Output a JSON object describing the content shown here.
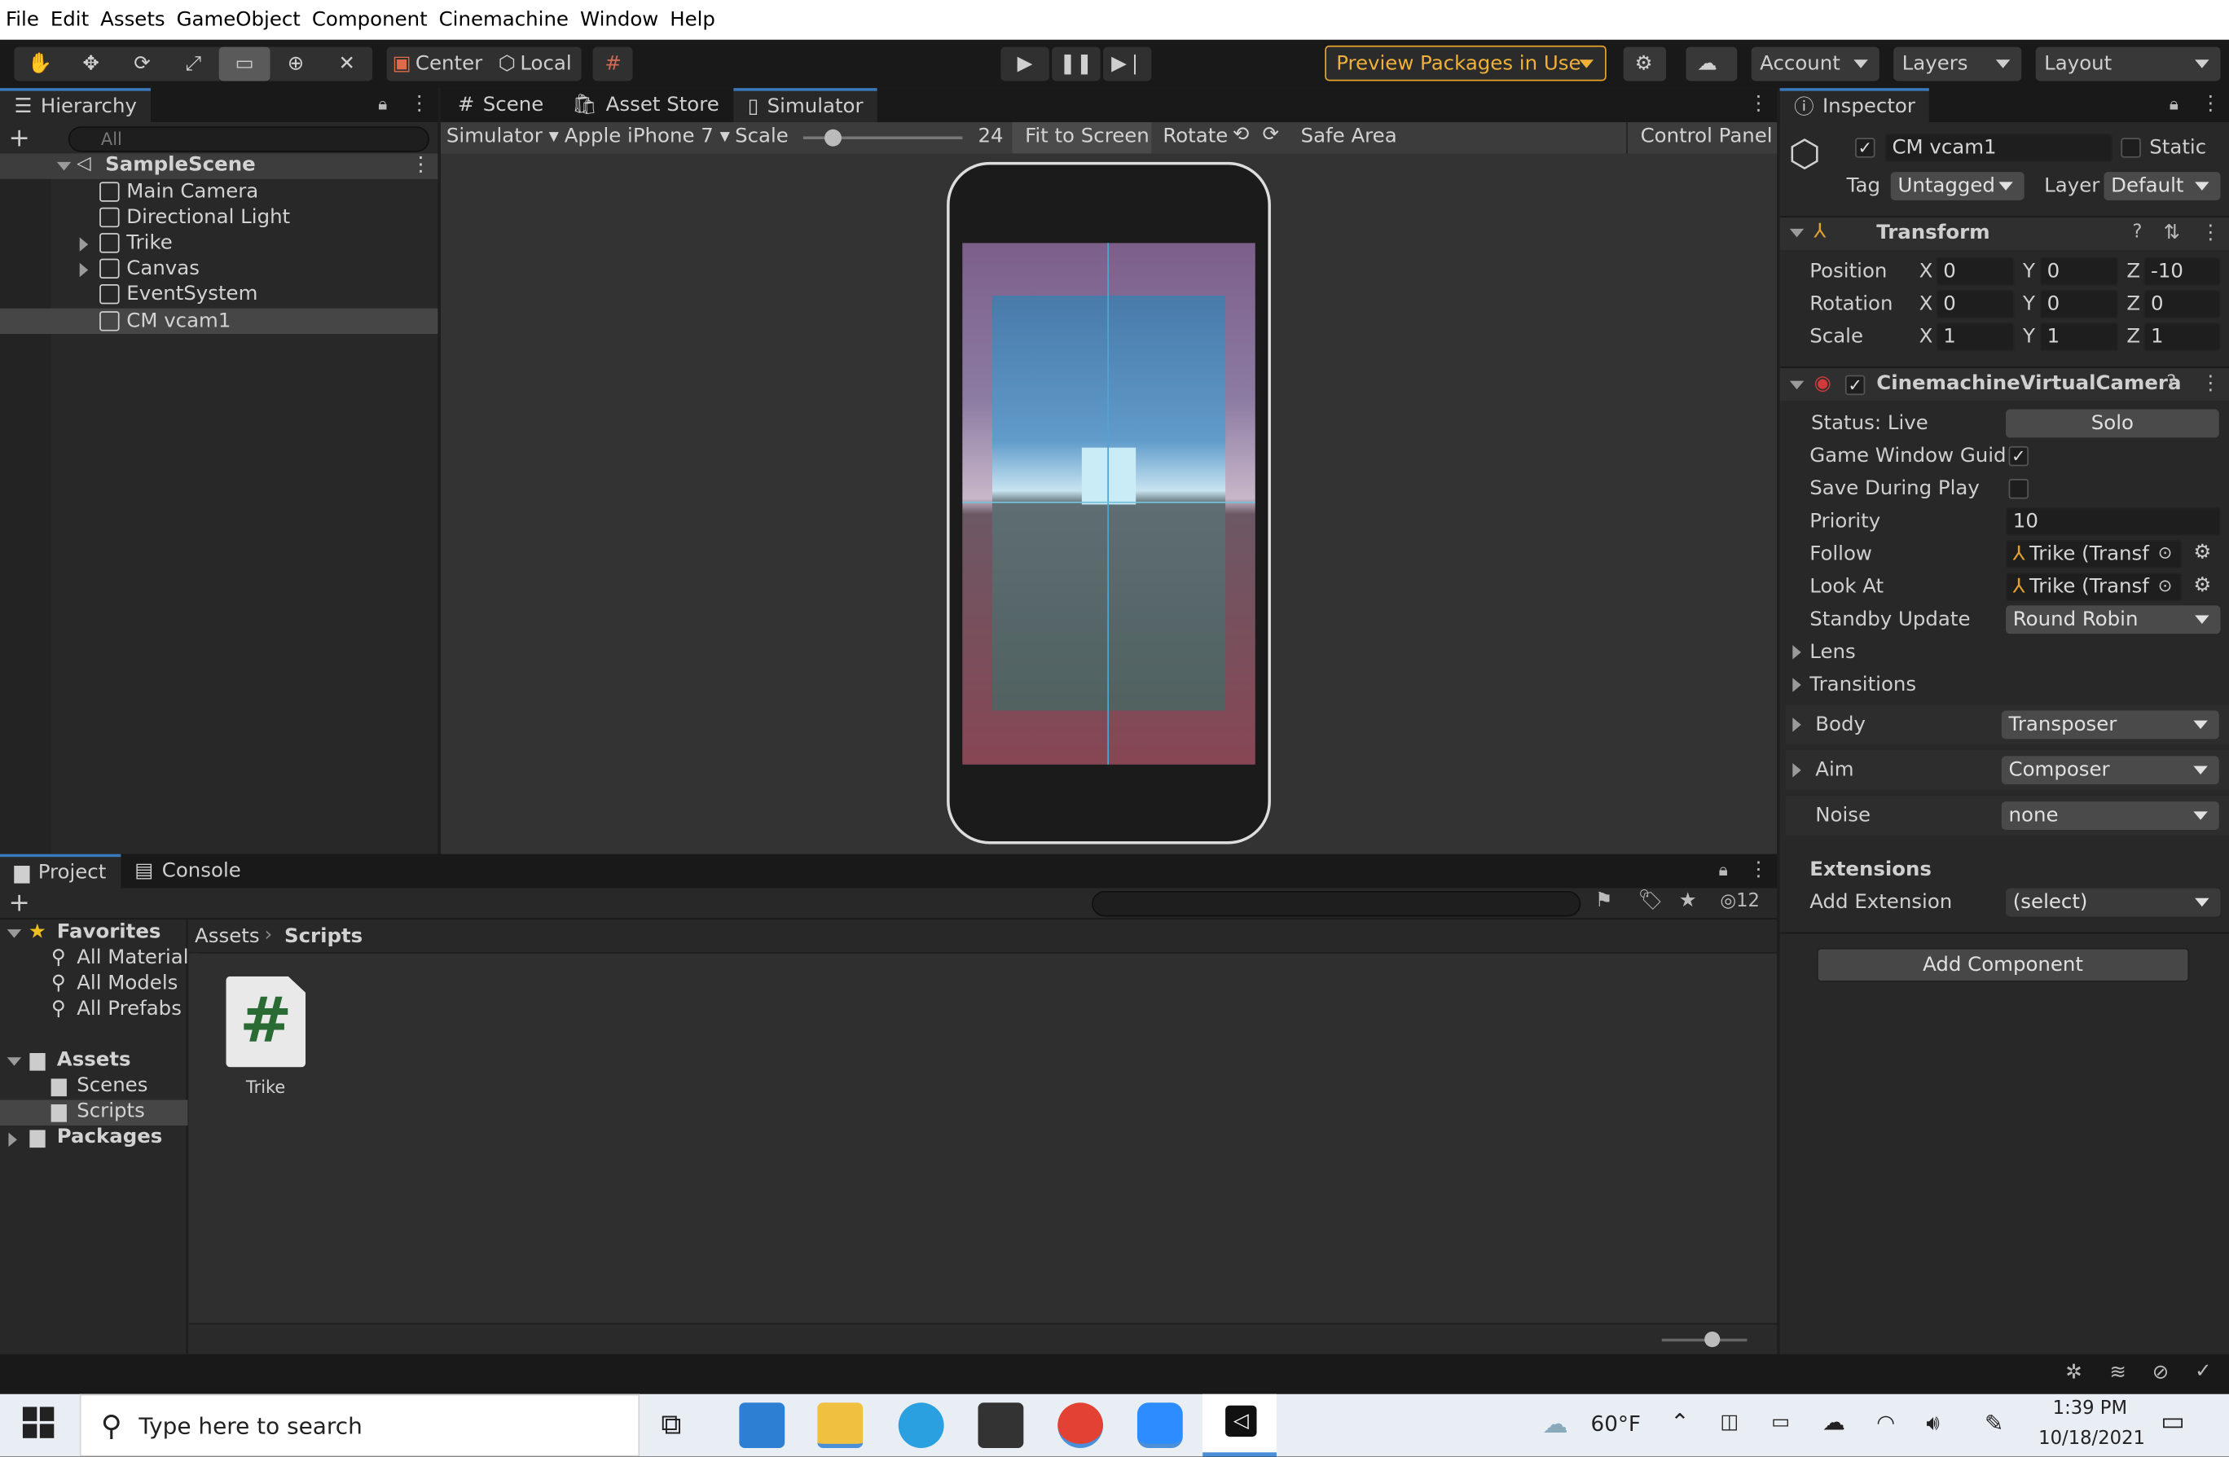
{
  "menubar": {
    "items": [
      "File",
      "Edit",
      "Assets",
      "GameObject",
      "Component",
      "Cinemachine",
      "Window",
      "Help"
    ]
  },
  "toolbar": {
    "pivot": "Center",
    "space": "Local",
    "preview_packages": "Preview Packages in Use",
    "account": "Account",
    "layers": "Layers",
    "layout": "Layout"
  },
  "hierarchy": {
    "tab": "Hierarchy",
    "search_placeholder": "All",
    "scene": "SampleScene",
    "items": [
      "Main Camera",
      "Directional Light",
      "Trike",
      "Canvas",
      "EventSystem",
      "CM vcam1"
    ]
  },
  "center_tabs": [
    "Scene",
    "Asset Store",
    "Simulator"
  ],
  "simulator_bar": {
    "mode": "Simulator",
    "device": "Apple iPhone 7",
    "scale_label": "Scale",
    "scale_value": "24",
    "fit": "Fit to Screen",
    "rotate": "Rotate",
    "safe_area": "Safe Area",
    "control_panel": "Control Panel"
  },
  "bottom_tabs": {
    "project": "Project",
    "console": "Console",
    "hidden_count": "12"
  },
  "project_tree": {
    "favorites": "Favorites",
    "favorites_items": [
      "All Materials",
      "All Models",
      "All Prefabs"
    ],
    "assets": "Assets",
    "assets_items": [
      "Scenes",
      "Scripts"
    ],
    "packages": "Packages"
  },
  "breadcrumb": {
    "root": "Assets",
    "current": "Scripts"
  },
  "asset_files": [
    {
      "name": "Trike",
      "glyph": "#"
    }
  ],
  "inspector": {
    "tab": "Inspector",
    "object_name": "CM vcam1",
    "static": "Static",
    "tag_label": "Tag",
    "tag_value": "Untagged",
    "layer_label": "Layer",
    "layer_value": "Default",
    "transform": {
      "title": "Transform",
      "rows": [
        {
          "label": "Position",
          "x": "0",
          "y": "0",
          "z": "-10"
        },
        {
          "label": "Rotation",
          "x": "0",
          "y": "0",
          "z": "0"
        },
        {
          "label": "Scale",
          "x": "1",
          "y": "1",
          "z": "1"
        }
      ]
    },
    "vcam": {
      "title": "CinemachineVirtualCamera",
      "status": "Status: Live",
      "solo": "Solo",
      "game_window_guides": "Game Window Guides",
      "save_during_play": "Save During Play",
      "priority_label": "Priority",
      "priority": "10",
      "follow_label": "Follow",
      "follow": "Trike (Transf",
      "look_at_label": "Look At",
      "look_at": "Trike (Transf",
      "standby_label": "Standby Update",
      "standby": "Round Robin",
      "lens": "Lens",
      "transitions": "Transitions",
      "body_label": "Body",
      "body": "Transposer",
      "aim_label": "Aim",
      "aim": "Composer",
      "noise_label": "Noise",
      "noise": "none",
      "extensions": "Extensions",
      "add_extension_label": "Add Extension",
      "add_extension": "(select)"
    },
    "add_component": "Add Component"
  },
  "taskbar": {
    "search_placeholder": "Type here to search",
    "weather": "60°F",
    "time": "1:39 PM",
    "date": "10/18/2021"
  },
  "colors": {
    "accent": "#3a79bb",
    "preview_border": "#e3a32c",
    "panel": "#282828"
  }
}
